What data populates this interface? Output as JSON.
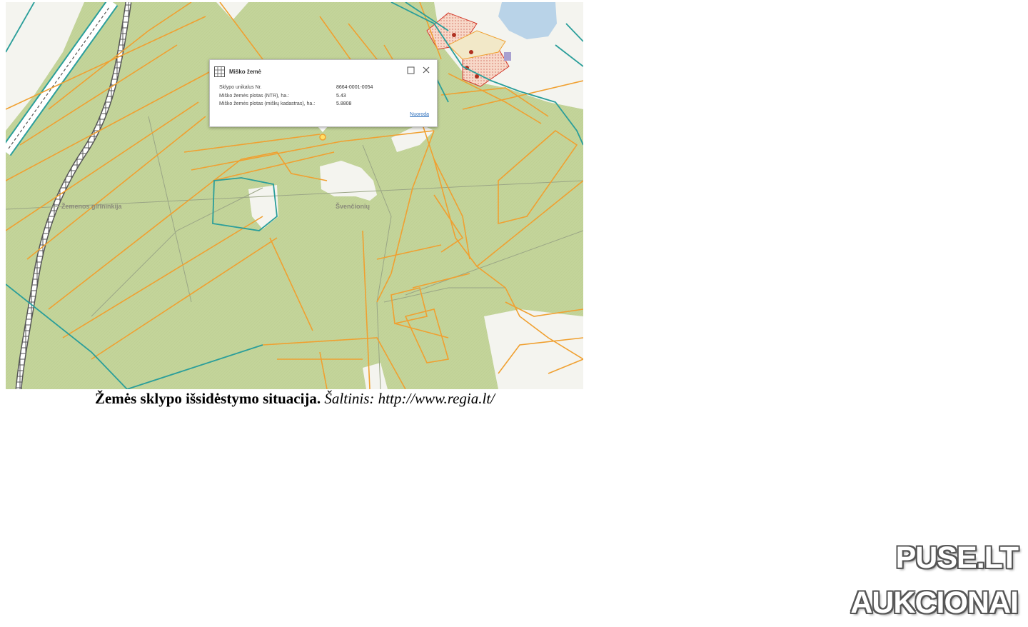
{
  "map": {
    "place_labels": [
      "Žemenos girininkija",
      "Švenčionių"
    ],
    "colors": {
      "forest": "#c3d49a",
      "open_land": "#f4f4ef",
      "parcel_line": "#f0a030",
      "boundary_line": "#2a9e9a",
      "railway": "#555555",
      "water": "#b9d3e8",
      "building": "#d33a2c"
    }
  },
  "popup": {
    "title": "Miško žemė",
    "rows": [
      {
        "label": "Sklypo unikalus Nr.",
        "value": "8664-0001-0054"
      },
      {
        "label": "Miško žemės plotas (NTR), ha.:",
        "value": "5.43"
      },
      {
        "label": "Miško žemės plotas (miškų kadastras), ha.:",
        "value": "5.8808"
      }
    ],
    "link": "Nuoroda",
    "icons": {
      "header": "grid-icon",
      "maximize": "maximize-icon",
      "close": "close-icon"
    }
  },
  "caption": {
    "bold": "Žemės sklypo išsidėstymo situacija.",
    "italic": "Šaltinis: http://www.regia.lt/"
  },
  "watermark": {
    "line1": "PUSE.LT",
    "line2": "AUKCIONAI"
  }
}
